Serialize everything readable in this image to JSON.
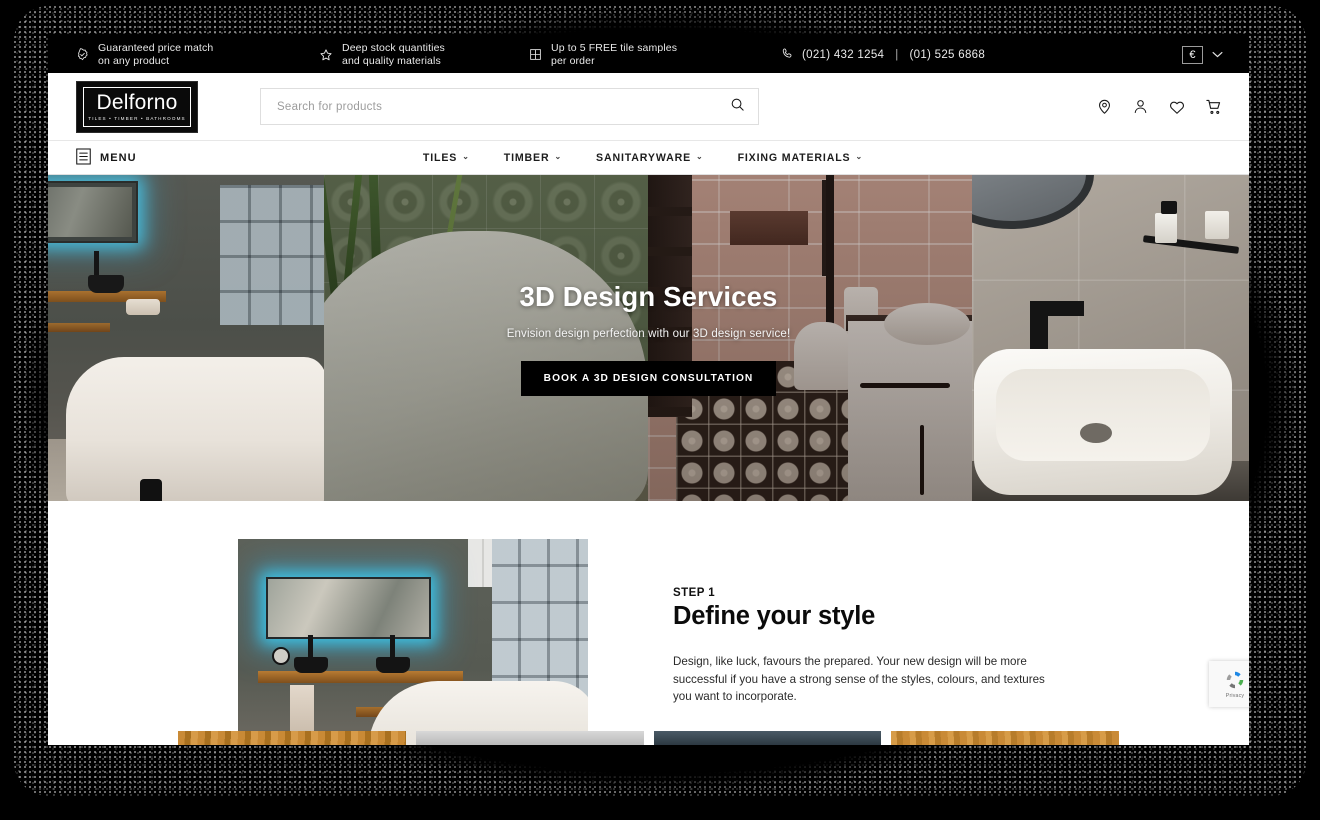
{
  "topbar": {
    "promos": [
      {
        "icon": "check-badge-icon",
        "line1": "Guaranteed price match",
        "line2": "on any product"
      },
      {
        "icon": "star-icon",
        "line1": "Deep stock quantities",
        "line2": "and quality materials"
      },
      {
        "icon": "grid-icon",
        "line1": "Up to 5 FREE tile samples",
        "line2": "per order"
      }
    ],
    "phone_icon": "phone-icon",
    "phone_1": "(021) 432 1254",
    "phone_separator": "|",
    "phone_2": "(01) 525 6868",
    "currency_symbol": "€",
    "currency_chevron": "⌄"
  },
  "header": {
    "logo_name": "Delforno",
    "logo_tagline": "TILES • TIMBER • BATHROOMS",
    "search_placeholder": "Search for products",
    "search_value": "",
    "search_icon": "search-icon",
    "icons": [
      {
        "name": "store-locator-icon",
        "glyph": "location-pin"
      },
      {
        "name": "account-icon",
        "glyph": "person"
      },
      {
        "name": "wishlist-icon",
        "glyph": "heart"
      },
      {
        "name": "cart-icon",
        "glyph": "shopping-cart"
      }
    ]
  },
  "nav": {
    "menu_label": "MENU",
    "menu_icon": "list-menu-icon",
    "links": [
      {
        "label": "TILES",
        "chevron": "⌄"
      },
      {
        "label": "TIMBER",
        "chevron": "⌄"
      },
      {
        "label": "SANITARYWARE",
        "chevron": "⌄"
      },
      {
        "label": "FIXING MATERIALS",
        "chevron": "⌄"
      }
    ]
  },
  "hero": {
    "title": "3D Design Services",
    "subtitle": "Envision design perfection with our 3D design service!",
    "cta_label": "BOOK A 3D DESIGN CONSULTATION",
    "panels": [
      {
        "alt": "Dark bathroom with LED backlit mirror, timber shelf and white freestanding bath"
      },
      {
        "alt": "Green patterned wall tiles with plant and white roll top bath"
      },
      {
        "alt": "Subway tiled shower with toilet, patterned encaustic floor tiles and white vanity"
      },
      {
        "alt": "Countertop basin with round mirror and black tap on beige tiles"
      }
    ]
  },
  "step": {
    "label": "STEP 1",
    "heading": "Define your style",
    "body": "Design, like luck, favours the prepared. Your new design will be more successful if you have a strong sense of the styles, colours, and textures you want to incorporate.",
    "image_alt": "Showroom bathroom with LED mirror, twin black basins on a timber shelf"
  },
  "recaptcha": {
    "label": "Privacy"
  },
  "colors": {
    "topbar_bg": "#000000",
    "page_bg": "#ffffff",
    "frame_bg": "#000000",
    "cta_bg": "#000000",
    "cta_text": "#ffffff",
    "led_accent": "#3cc8eb",
    "text_primary": "#0b0b0b"
  }
}
